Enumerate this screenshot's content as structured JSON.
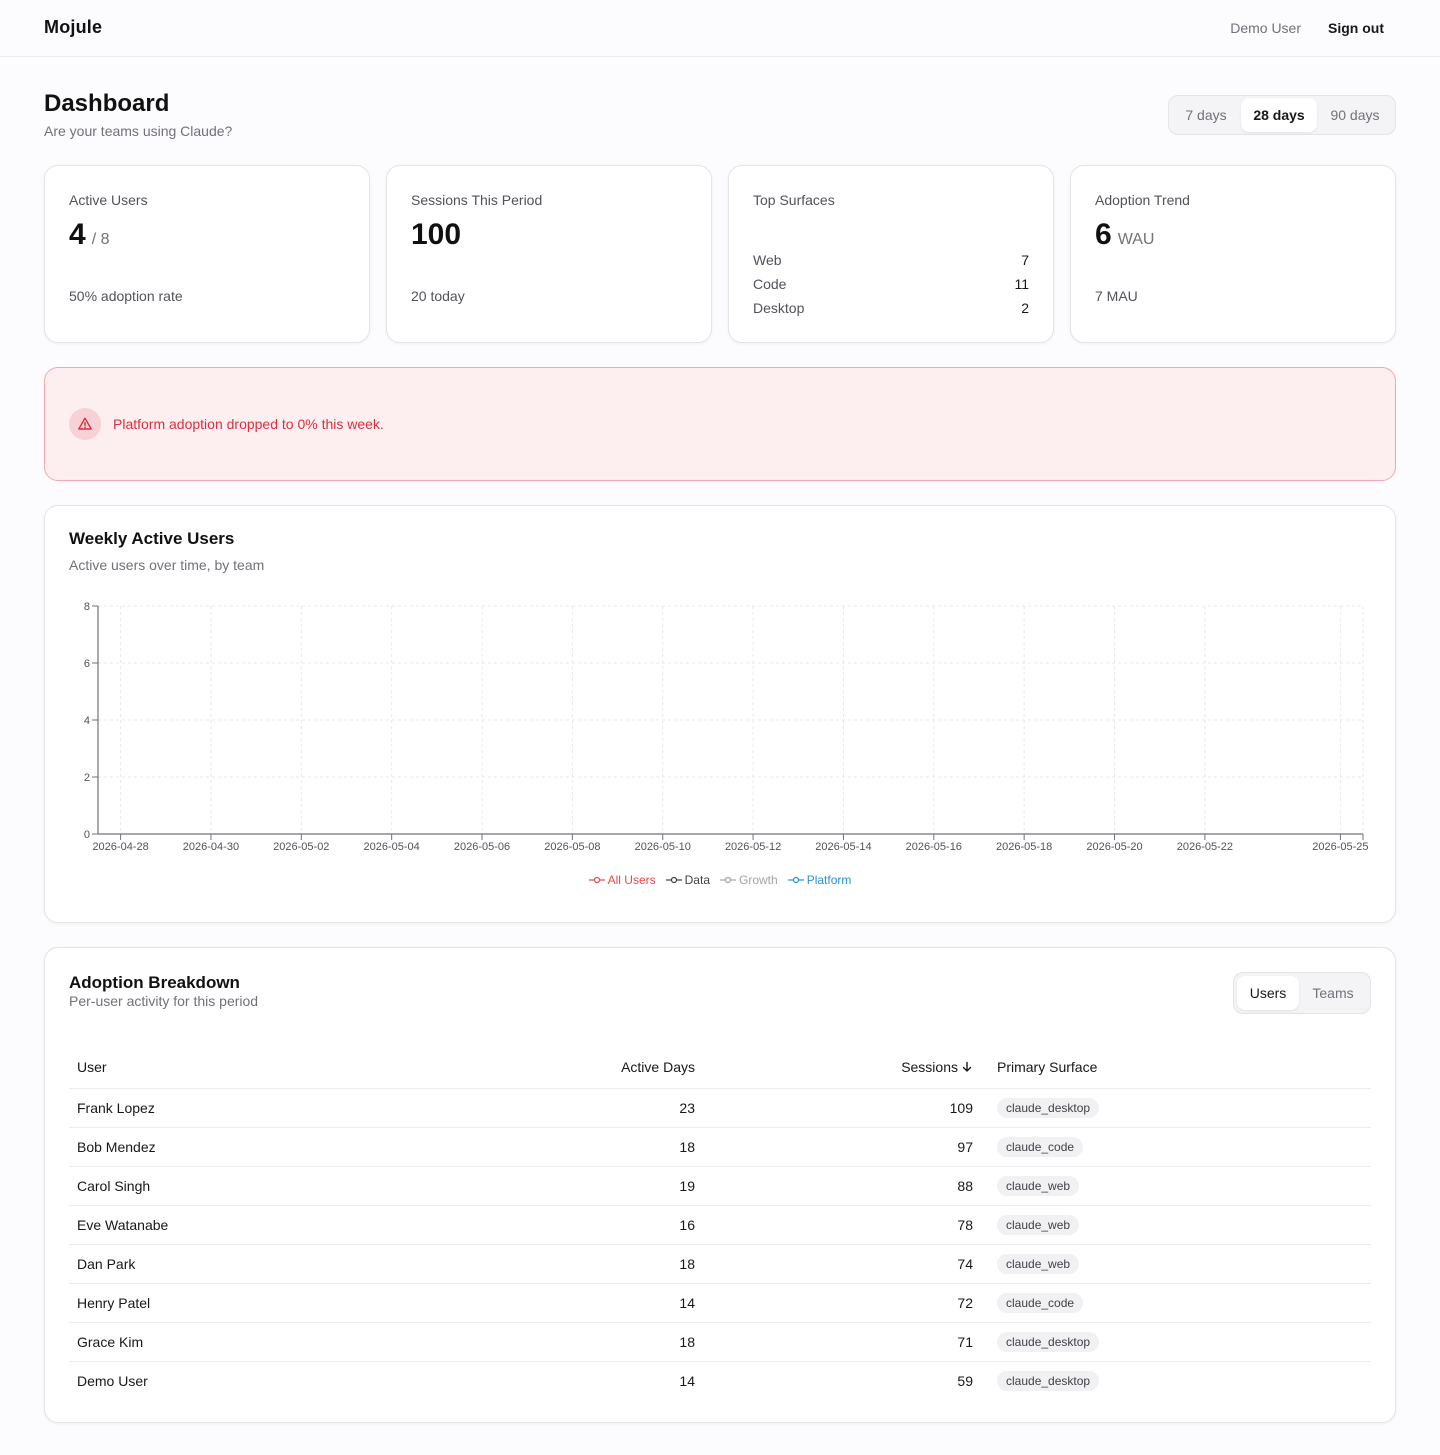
{
  "app": {
    "brand": "Mojule",
    "user_name": "Demo User",
    "signout_label": "Sign out"
  },
  "page": {
    "title": "Dashboard",
    "subtitle": "Are your teams using Claude?"
  },
  "range": {
    "options": [
      "7 days",
      "28 days",
      "90 days"
    ],
    "selected": "28 days"
  },
  "stats": {
    "active_users": {
      "label": "Active Users",
      "value": "4",
      "suffix": "/ 8",
      "foot": "50% adoption rate"
    },
    "sessions": {
      "label": "Sessions This Period",
      "value": "100",
      "foot": "20 today"
    },
    "surfaces": {
      "label": "Top Surfaces",
      "rows": [
        {
          "name": "Web",
          "value": "7"
        },
        {
          "name": "Code",
          "value": "11"
        },
        {
          "name": "Desktop",
          "value": "2"
        }
      ]
    },
    "trend": {
      "label": "Adoption Trend",
      "value": "6",
      "suffix": "WAU",
      "foot": "7 MAU"
    }
  },
  "alert": {
    "text": "Platform adoption dropped to 0% this week.",
    "icon": "warning-triangle-icon"
  },
  "wau_section": {
    "title": "Weekly Active Users",
    "subtitle": "Active users over time, by team"
  },
  "chart_data": {
    "type": "line",
    "title": "Weekly Active Users",
    "x": [
      "2026-04-28",
      "2026-04-30",
      "2026-05-02",
      "2026-05-04",
      "2026-05-06",
      "2026-05-08",
      "2026-05-10",
      "2026-05-12",
      "2026-05-14",
      "2026-05-16",
      "2026-05-18",
      "2026-05-20",
      "2026-05-22",
      "2026-05-25"
    ],
    "y_ticks": [
      "0",
      "2",
      "4",
      "6",
      "8"
    ],
    "ylim": [
      0,
      8
    ],
    "grid": true,
    "legend_position": "bottom",
    "series": [
      {
        "name": "All Users",
        "color": "#e5484d",
        "values": []
      },
      {
        "name": "Data",
        "color": "#3f3f46",
        "values": []
      },
      {
        "name": "Growth",
        "color": "#a1a1aa",
        "values": []
      },
      {
        "name": "Platform",
        "color": "#2b8fd6",
        "values": []
      }
    ]
  },
  "breakdown": {
    "title": "Adoption Breakdown",
    "subtitle": "Per-user activity for this period",
    "tabs": [
      "Users",
      "Teams"
    ],
    "selected_tab": "Users",
    "columns": {
      "user": "User",
      "active_days": "Active Days",
      "sessions": "Sessions",
      "surface": "Primary Surface"
    },
    "sort_icon": "arrow-down-icon",
    "rows": [
      {
        "user": "Frank Lopez",
        "active_days": "23",
        "sessions": "109",
        "surface": "claude_desktop"
      },
      {
        "user": "Bob Mendez",
        "active_days": "18",
        "sessions": "97",
        "surface": "claude_code"
      },
      {
        "user": "Carol Singh",
        "active_days": "19",
        "sessions": "88",
        "surface": "claude_web"
      },
      {
        "user": "Eve Watanabe",
        "active_days": "16",
        "sessions": "78",
        "surface": "claude_web"
      },
      {
        "user": "Dan Park",
        "active_days": "18",
        "sessions": "74",
        "surface": "claude_web"
      },
      {
        "user": "Henry Patel",
        "active_days": "14",
        "sessions": "72",
        "surface": "claude_code"
      },
      {
        "user": "Grace Kim",
        "active_days": "18",
        "sessions": "71",
        "surface": "claude_desktop"
      },
      {
        "user": "Demo User",
        "active_days": "14",
        "sessions": "59",
        "surface": "claude_desktop"
      }
    ]
  }
}
